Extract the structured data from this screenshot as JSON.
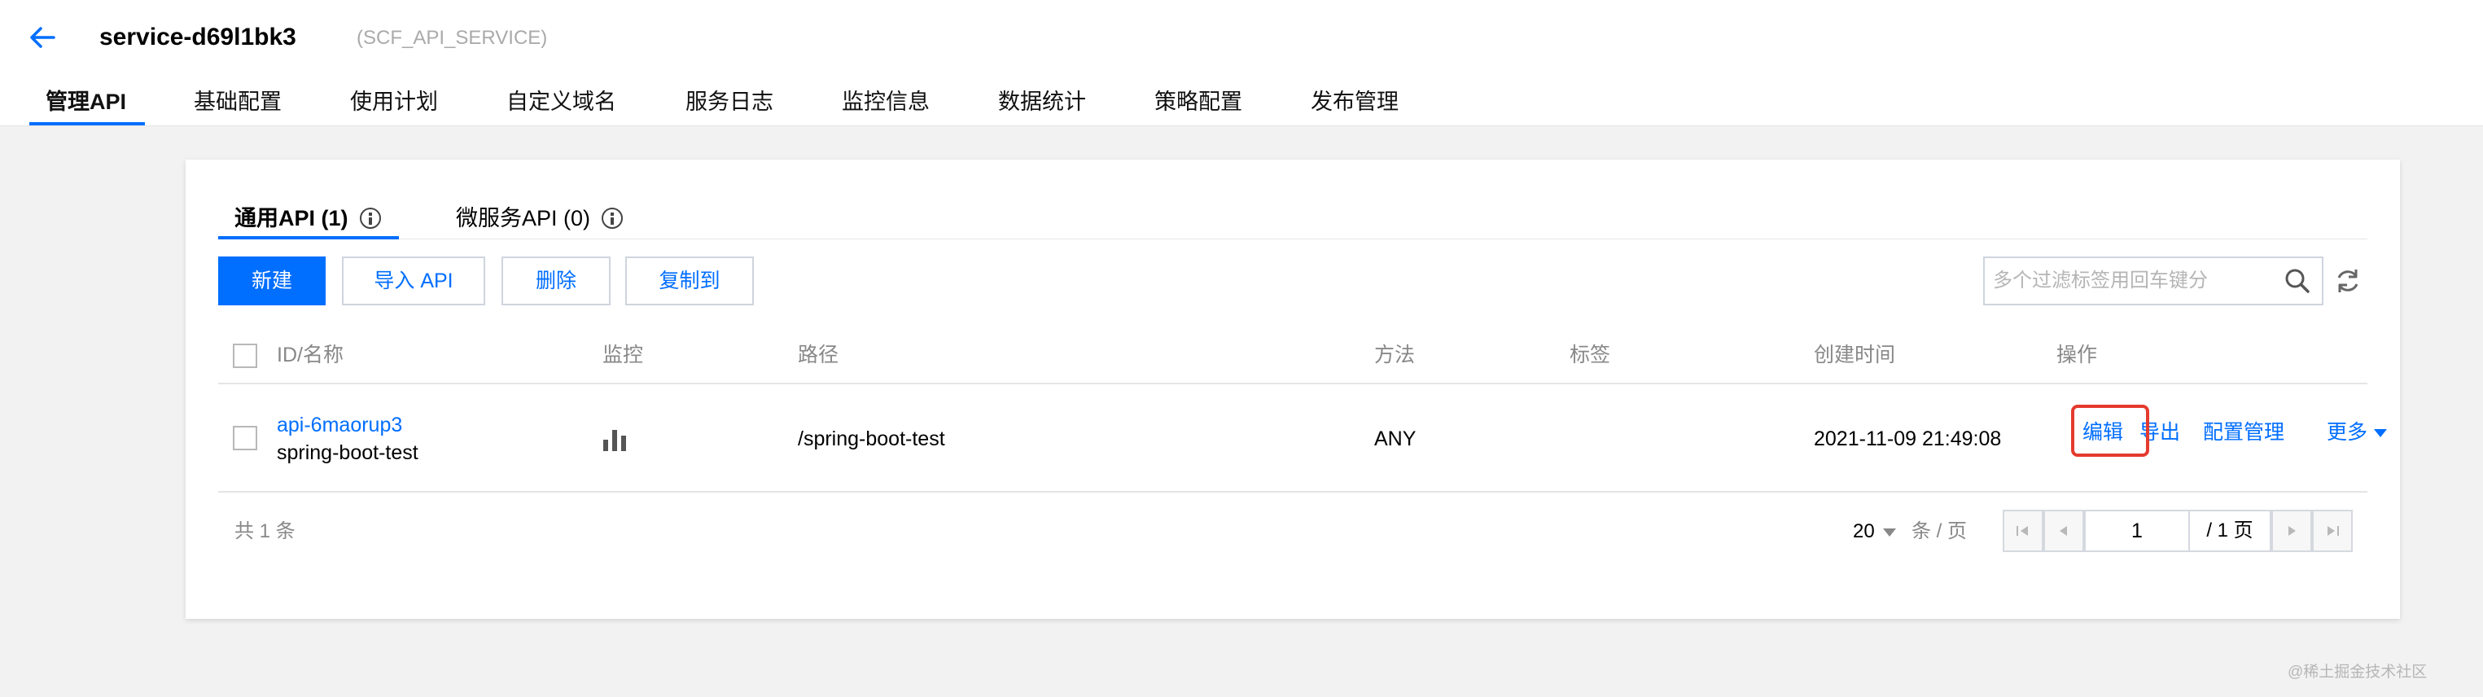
{
  "header": {
    "service_name": "service-d69l1bk3",
    "service_type": "(SCF_API_SERVICE)",
    "tabs": [
      {
        "label": "管理API",
        "active": true
      },
      {
        "label": "基础配置"
      },
      {
        "label": "使用计划"
      },
      {
        "label": "自定义域名"
      },
      {
        "label": "服务日志"
      },
      {
        "label": "监控信息"
      },
      {
        "label": "数据统计"
      },
      {
        "label": "策略配置"
      },
      {
        "label": "发布管理"
      }
    ]
  },
  "subtabs": [
    {
      "label": "通用API (1)",
      "active": true
    },
    {
      "label": "微服务API (0)"
    }
  ],
  "toolbar": {
    "new_label": "新建",
    "import_label": "导入 API",
    "delete_label": "删除",
    "copy_label": "复制到",
    "search_placeholder": "多个过滤标签用回车键分"
  },
  "table": {
    "columns": [
      "ID/名称",
      "监控",
      "路径",
      "方法",
      "标签",
      "创建时间",
      "操作"
    ],
    "rows": [
      {
        "id": "api-6maorup3",
        "name": "spring-boot-test",
        "path": "/spring-boot-test",
        "method": "ANY",
        "tags": "",
        "created": "2021-11-09 21:49:08",
        "actions": {
          "edit": "编辑",
          "export": "导出",
          "config": "配置管理",
          "more": "更多"
        }
      }
    ]
  },
  "footer": {
    "total": "共 1 条",
    "page_size": "20",
    "per_page": "条 / 页",
    "current_page": "1",
    "total_pages": "/ 1 页"
  },
  "watermark": "@稀土掘金技术社区",
  "colors": {
    "accent": "#006eff",
    "highlight": "#e53a2e"
  }
}
